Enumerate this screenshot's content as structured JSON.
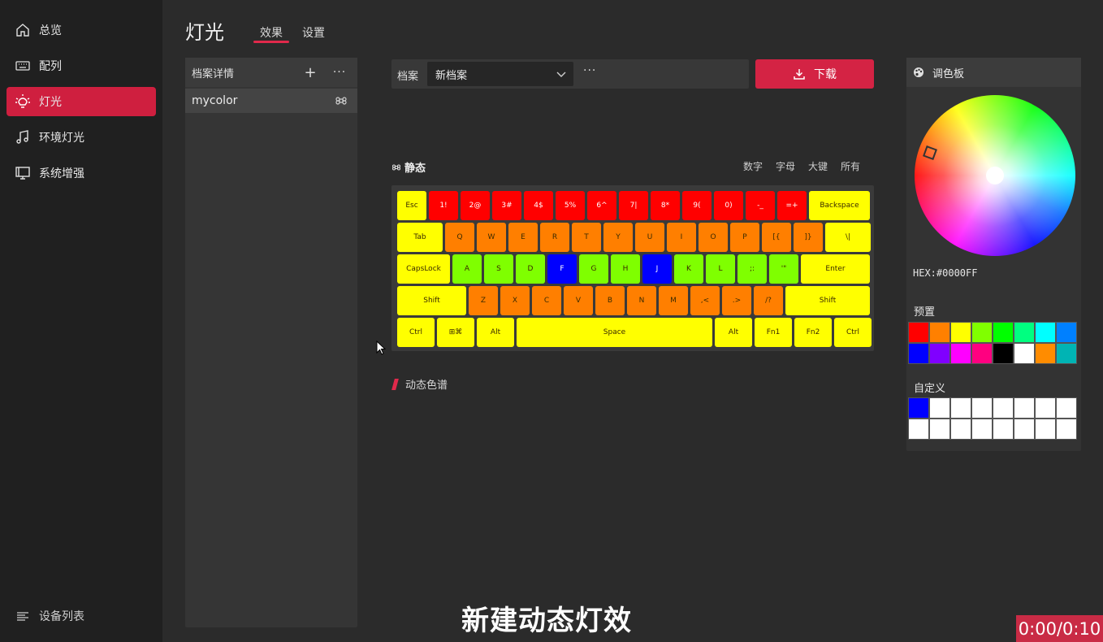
{
  "sidebar": {
    "items": [
      {
        "label": "总览",
        "icon": "home-icon"
      },
      {
        "label": "配列",
        "icon": "keyboard-icon"
      },
      {
        "label": "灯光",
        "icon": "light-bulb-icon",
        "active": true
      },
      {
        "label": "环境灯光",
        "icon": "music-note-icon"
      },
      {
        "label": "系统增强",
        "icon": "monitor-icon"
      }
    ],
    "footer_label": "设备列表",
    "accent_color": "#cf1f3f"
  },
  "header": {
    "title": "灯光",
    "tabs": [
      "效果",
      "设置"
    ],
    "active_tab": "效果"
  },
  "profile_panel": {
    "title": "档案详情",
    "add_label": "+",
    "more_label": "···",
    "items": [
      "mycolor"
    ]
  },
  "profile_bar": {
    "label": "档案",
    "selected": "新档案",
    "more_label": "···",
    "download_label": "下载"
  },
  "static_section": {
    "title": "静态",
    "filters": [
      "数字",
      "字母",
      "大键",
      "所有"
    ]
  },
  "keyboard": {
    "colors": {
      "Y": "#ffff00",
      "R": "#ff0000",
      "O": "#ff7f00",
      "G": "#7fff00",
      "B": "#0000ff"
    },
    "rows": [
      [
        [
          "Esc",
          "Y",
          1
        ],
        [
          "1!",
          "R",
          1
        ],
        [
          "2@",
          "R",
          1
        ],
        [
          "3#",
          "R",
          1
        ],
        [
          "4$",
          "R",
          1
        ],
        [
          "5%",
          "R",
          1
        ],
        [
          "6^",
          "R",
          1
        ],
        [
          "7|",
          "R",
          1
        ],
        [
          "8*",
          "R",
          1
        ],
        [
          "9(",
          "R",
          1
        ],
        [
          "0)",
          "R",
          1
        ],
        [
          "-_",
          "R",
          1
        ],
        [
          "=+",
          "R",
          1
        ],
        [
          "Backspace",
          "Y",
          2
        ]
      ],
      [
        [
          "Tab",
          "Y",
          1.5
        ],
        [
          "Q",
          "O",
          1
        ],
        [
          "W",
          "O",
          1
        ],
        [
          "E",
          "O",
          1
        ],
        [
          "R",
          "O",
          1
        ],
        [
          "T",
          "O",
          1
        ],
        [
          "Y",
          "O",
          1
        ],
        [
          "U",
          "O",
          1
        ],
        [
          "I",
          "O",
          1
        ],
        [
          "O",
          "O",
          1
        ],
        [
          "P",
          "O",
          1
        ],
        [
          "[{",
          "O",
          1
        ],
        [
          "]}",
          "O",
          1
        ],
        [
          "\\|",
          "Y",
          1.5
        ]
      ],
      [
        [
          "CapsLock",
          "Y",
          1.75
        ],
        [
          "A",
          "G",
          1
        ],
        [
          "S",
          "G",
          1
        ],
        [
          "D",
          "G",
          1
        ],
        [
          "F",
          "B",
          1
        ],
        [
          "G",
          "G",
          1
        ],
        [
          "H",
          "G",
          1
        ],
        [
          "J",
          "B",
          1
        ],
        [
          "K",
          "G",
          1
        ],
        [
          "L",
          "G",
          1
        ],
        [
          ";:",
          "G",
          1
        ],
        [
          "'\"",
          "G",
          1
        ],
        [
          "Enter",
          "Y",
          2.25
        ]
      ],
      [
        [
          "Shift",
          "Y",
          2.25
        ],
        [
          "Z",
          "O",
          1
        ],
        [
          "X",
          "O",
          1
        ],
        [
          "C",
          "O",
          1
        ],
        [
          "V",
          "O",
          1
        ],
        [
          "B",
          "O",
          1
        ],
        [
          "N",
          "O",
          1
        ],
        [
          "M",
          "O",
          1
        ],
        [
          ",<",
          "O",
          1
        ],
        [
          ".>",
          "O",
          1
        ],
        [
          "/?",
          "O",
          1
        ],
        [
          "Shift",
          "Y",
          2.75
        ]
      ],
      [
        [
          "Ctrl",
          "Y",
          1.25
        ],
        [
          "⊞⌘",
          "Y",
          1.25
        ],
        [
          "Alt",
          "Y",
          1.25
        ],
        [
          "Space",
          "Y",
          6.25
        ],
        [
          "Alt",
          "Y",
          1.25
        ],
        [
          "Fn1",
          "Y",
          1.25
        ],
        [
          "Fn2",
          "Y",
          1.25
        ],
        [
          "Ctrl",
          "Y",
          1.25
        ]
      ]
    ]
  },
  "dynamic_section": {
    "title": "动态色谱"
  },
  "palette": {
    "title": "调色板",
    "hex_readout": "HEX:#0000FF",
    "preset_title": "预置",
    "presets": [
      "#ff0000",
      "#ff8000",
      "#ffff00",
      "#80ff00",
      "#00ff00",
      "#00ff80",
      "#00ffff",
      "#0080ff",
      "#0000ff",
      "#8000ff",
      "#ff00ff",
      "#ff0080",
      "#000000",
      "#ffffff",
      "#ff8c00",
      "#00b4b4"
    ],
    "custom_title": "自定义",
    "custom": [
      "#0000ff",
      "#ffffff",
      "#ffffff",
      "#ffffff",
      "#ffffff",
      "#ffffff",
      "#ffffff",
      "#ffffff",
      "#ffffff",
      "#ffffff",
      "#ffffff",
      "#ffffff",
      "#ffffff",
      "#ffffff",
      "#ffffff",
      "#ffffff"
    ]
  },
  "caption": "新建动态灯效",
  "timer": "0:00/0:10"
}
